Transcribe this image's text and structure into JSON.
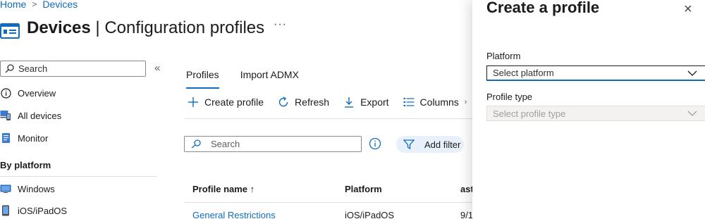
{
  "breadcrumb": {
    "home": "Home",
    "devices": "Devices"
  },
  "header": {
    "title_bold": "Devices",
    "title_sep": " | ",
    "title_rest": "Configuration profiles",
    "more": "···"
  },
  "left_nav": {
    "search_placeholder": "Search",
    "collapse": "«",
    "items": [
      {
        "label": "Overview",
        "icon": "info-icon"
      },
      {
        "label": "All devices",
        "icon": "devices-icon"
      },
      {
        "label": "Monitor",
        "icon": "monitor-icon"
      }
    ],
    "section_heading": "By platform",
    "platform_items": [
      {
        "label": "Windows",
        "icon": "windows-icon"
      },
      {
        "label": "iOS/iPadOS",
        "icon": "ipad-icon"
      }
    ]
  },
  "tabs": [
    {
      "label": "Profiles",
      "active": true
    },
    {
      "label": "Import ADMX",
      "active": false
    }
  ],
  "toolbar": {
    "create": "Create profile",
    "refresh": "Refresh",
    "export": "Export",
    "columns": "Columns"
  },
  "filter_bar": {
    "search_placeholder": "Search",
    "add_filter": "Add filter"
  },
  "table": {
    "columns": [
      "Profile name ↑",
      "Platform",
      "ast"
    ],
    "rows": [
      {
        "name": "General Restrictions",
        "platform": "iOS/iPadOS",
        "last": "9/1"
      }
    ]
  },
  "panel": {
    "title": "Create a profile",
    "close": "×",
    "platform_label": "Platform",
    "platform_value": "Select platform",
    "profile_type_label": "Profile type",
    "profile_type_value": "Select profile type"
  },
  "colors": {
    "accent": "#0f6cbd",
    "filter_bg": "#e8f1fb"
  }
}
